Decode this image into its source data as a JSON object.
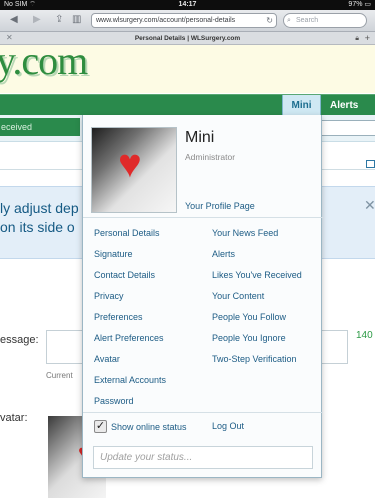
{
  "status_bar": {
    "carrier": "No SIM ⌔",
    "time": "14:17",
    "battery": "97% ▭"
  },
  "browser": {
    "url": "www.wlsurgery.com/account/personal-details",
    "search_placeholder": "Search",
    "tab_title": "Personal Details | WLSurgery.com",
    "icons": [
      "back-arrow-icon",
      "forward-arrow-icon",
      "share-icon",
      "bookmarks-icon",
      "reload-icon",
      "search-icon",
      "close-icon",
      "lock-icon",
      "plus-icon"
    ]
  },
  "site": {
    "logo_text": "y.com",
    "nav": {
      "mini": "Mini",
      "alerts": "Alerts"
    },
    "subnav_tab": "eceived"
  },
  "notice": {
    "line1": "ly adjust dep                    re you missing",
    "line2": " on its side o"
  },
  "form": {
    "message_label": "essage:",
    "char_count": "140",
    "current_text": "Current",
    "avatar_label": "vatar:"
  },
  "menu": {
    "user_name": "Mini",
    "user_role": "Administrator",
    "profile_link": "Your Profile Page",
    "left_links": [
      "Personal Details",
      "Signature",
      "Contact Details",
      "Privacy",
      "Preferences",
      "Alert Preferences",
      "Avatar",
      "External Accounts",
      "Password"
    ],
    "right_links": [
      "Your News Feed",
      "Alerts",
      "Likes You've Received",
      "Your Content",
      "People You Follow",
      "People You Ignore",
      "Two-Step Verification"
    ],
    "show_online_label": "Show online status",
    "show_online_checked": true,
    "logout": "Log Out",
    "status_placeholder": "Update your status..."
  },
  "colors": {
    "nav_green": "#2a8a4c",
    "link_blue": "#1d5c85",
    "notice_bg": "#e3eef8"
  }
}
